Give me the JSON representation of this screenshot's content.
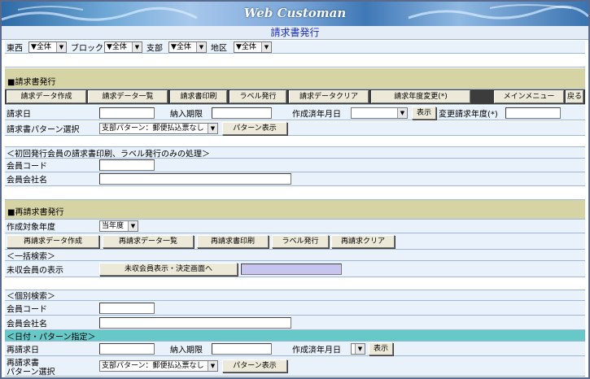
{
  "app": {
    "title": "Web Customan",
    "subtitle": "請求書発行"
  },
  "filters": {
    "items": [
      {
        "label": "東西",
        "value": "▼全体"
      },
      {
        "label": "ブロック",
        "value": "▼全体"
      },
      {
        "label": "支部",
        "value": "▼全体"
      },
      {
        "label": "地区",
        "value": "▼全体"
      }
    ]
  },
  "invoice": {
    "heading": "■請求書発行",
    "buttons": [
      "請求データ作成",
      "請求データ一覧",
      "請求書印刷",
      "ラベル発行",
      "請求データクリア",
      "請求年度変更(*)",
      "メインメニュー",
      "戻る"
    ],
    "date_label": "請求日",
    "due_label": "納入期限",
    "created_label": "作成済年月日",
    "show_label": "表示",
    "change_year_label": "変更請求年度(*)",
    "pattern_label": "請求書パターン選択",
    "pattern_value": "支部パターン：郵便払込票なし",
    "pattern_btn": "パターン表示",
    "first_note": "＜初回発行会員の請求書印刷、ラベル発行のみの処理＞",
    "member_code_label": "会員コード",
    "member_company_label": "会員会社名"
  },
  "reissue": {
    "heading": "■再請求書発行",
    "year_label": "作成対象年度",
    "year_value": "当年度",
    "buttons": [
      "再請求データ作成",
      "再請求データ一覧",
      "再請求書印刷",
      "ラベル発行",
      "再請求クリア"
    ],
    "bulk_note": "＜一括検索＞",
    "unpaid_label": "未収会員の表示",
    "unpaid_btn": "未収会員表示・決定画面へ",
    "individual_note": "＜個別検索＞",
    "member_code_label": "会員コード",
    "member_company_label": "会員会社名",
    "date_pattern_note": "＜日付・パターン指定＞",
    "date_label": "再請求日",
    "due_label": "納入期限",
    "created_label": "作成済年月日",
    "show_label": "表示",
    "pattern_label_1": "再請求書",
    "pattern_label_2": "パターン選択",
    "pattern_value": "支部パターン：郵便払込票なし",
    "pattern_btn": "パターン表示"
  }
}
